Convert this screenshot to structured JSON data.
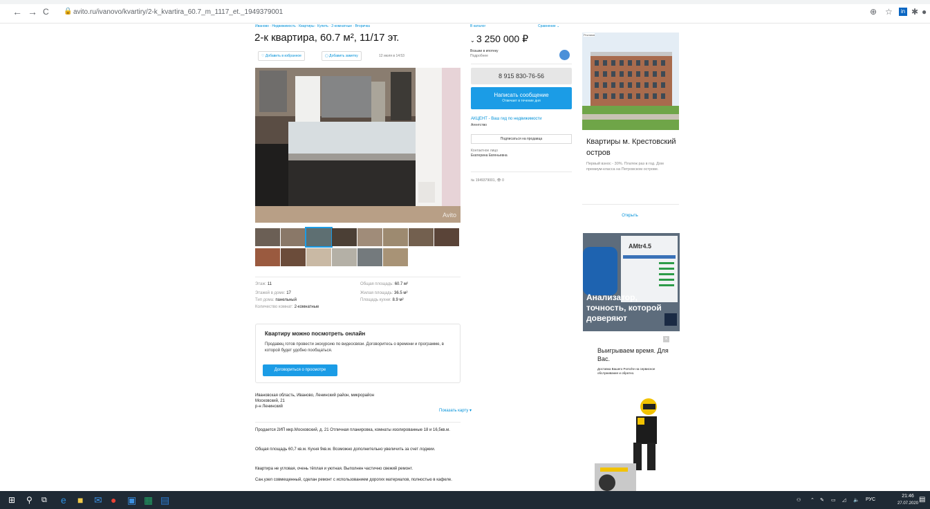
{
  "browser": {
    "url": "avito.ru/ivanovo/kvartiry/2-k_kvartira_60.7_m_1117_et._1949379001",
    "back_icon": "←",
    "forward_icon": "→",
    "reload_icon": "C"
  },
  "listing": {
    "breadcrumbs": "Иваново · Недвижимость · Квартиры · Купить · 2-комнатные · Вторичка",
    "title": "2-к квартира, 60.7 м², 11/17 эт.",
    "add_favorite": "Добавить в избранное",
    "add_note": "Добавить заметку",
    "date": "12 июля в 14:53",
    "watermark": "Avito",
    "params_left": [
      {
        "label": "Этаж:",
        "value": "11"
      },
      {
        "label": "Этажей в доме:",
        "value": "17"
      },
      {
        "label": "Тип дома:",
        "value": "панельный"
      },
      {
        "label": "Количество комнат:",
        "value": "2-комнатные"
      }
    ],
    "params_right": [
      {
        "label": "Общая площадь:",
        "value": "60.7 м²"
      },
      {
        "label": "Жилая площадь:",
        "value": "36.5 м²"
      },
      {
        "label": "Площадь кухни:",
        "value": "8.9 м²"
      }
    ],
    "online": {
      "heading": "Квартиру можно посмотреть онлайн",
      "text": "Продавец готов провести экскурсию по видеосвязи. Договоритесь о времени и программе, в которой будет удобно пообщаться.",
      "button": "Договориться о просмотре"
    },
    "address_1": "Ивановская область, Иваново, Ленинский район, микрорайон",
    "address_2": "Московский, 21",
    "address_3": "р-н Ленинский",
    "show_map": "Показать карту",
    "description": [
      "Продается 2ИП мкр.Московский, д. 21 Отличная планировка, комнаты изолированные 18 и 16,5кв.м.",
      "Общая площадь 60,7 кв.м. Кухня 9кв.м. Возможно дополнительно увеличить за счет лоджии.",
      "Квартира не угловая, очень тёплая и уютная. Выполнен частично свежий ремонт.",
      "Сан.узел совмещенный, сделан ремонт с использованием дорогих материалов, полностью в кафеле."
    ]
  },
  "sidebar": {
    "catalog": "В каталог",
    "compare": "Сравнение",
    "price": "3 250 000 ₽",
    "delivery": "Возьми в ипотеку",
    "delivery_sub": "Подробнее",
    "phone": "8 915 830-76-56",
    "message_button": "Написать сообщение",
    "message_sub": "Отвечает в течение дня",
    "seller_name": "АКЦЕНТ - Ваш гид по недвижимости",
    "seller_type": "Агентство",
    "subscribe": "Подписаться на продавца",
    "contact_label": "Контактное лицо",
    "contact_name": "Екатерина Евгеньевна",
    "ad_number": "№ 1949379001,  👁 0"
  },
  "ads": {
    "ad1_label": "Реклама",
    "ad1_heading": "Квартиры м. Крестовский остров",
    "ad1_text": "Первый взнос - 30%. Платеж раз в год. Дом премиум-класса на Петровском острове.",
    "ad1_link": "Открыть",
    "ad2_caption": "Анализатор, точность, которой доверяют",
    "ad2_brand": "AMtr4.5",
    "ad3_heading": "Выигрываем время. Для Вас.",
    "ad3_text": "Доставка Вашего Porsche на сервисное обслуживание и обратно."
  },
  "taskbar": {
    "lang": "РУС",
    "time": "21:46",
    "date": "27.07.2020"
  }
}
